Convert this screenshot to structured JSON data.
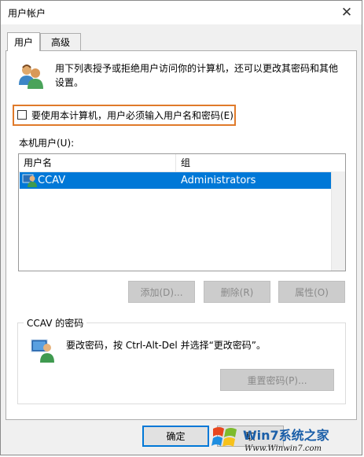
{
  "window": {
    "title": "用户帐户",
    "close_glyph": "✕"
  },
  "tabs": [
    {
      "label": "用户",
      "active": true
    },
    {
      "label": "高级",
      "active": false
    }
  ],
  "intro": {
    "text": "用下列表授予或拒绝用户访问你的计算机，还可以更改其密码和其他设置。",
    "icon": "users-icon"
  },
  "require_login": {
    "label": "要使用本计算机，用户必须输入用户名和密码(E)",
    "checked": false,
    "highlight_color": "#e07a2a"
  },
  "users": {
    "label": "本机用户(U):",
    "columns": [
      "用户名",
      "组"
    ],
    "rows": [
      {
        "name": "CCAV",
        "group": "Administrators",
        "selected": true,
        "icon": "user-icon"
      }
    ]
  },
  "user_actions": {
    "add": "添加(D)...",
    "remove": "删除(R)",
    "properties": "属性(O)"
  },
  "password": {
    "group_title": "CCAV 的密码",
    "text": "要改密码，按 Ctrl-Alt-Del 并选择“更改密码”。",
    "reset_button": "重置密码(P)...",
    "icon": "password-user-icon"
  },
  "dialog_buttons": {
    "ok": "确定",
    "cancel": "取"
  },
  "watermark": {
    "brand": "Win7系统之家",
    "url": "Www.Winwin7.com"
  },
  "colors": {
    "selection": "#0078d7",
    "accent": "#0078d7"
  }
}
